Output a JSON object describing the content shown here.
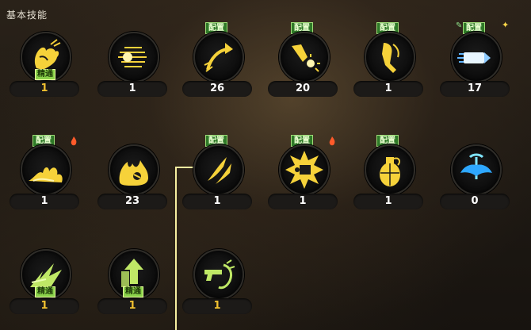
{
  "panel": {
    "title": "基本技能"
  },
  "skills": [
    {
      "count": "1",
      "count_color": "gold",
      "badge": "",
      "mastery": "精通",
      "icon": "muscle-arm-icon"
    },
    {
      "count": "1",
      "count_color": "white",
      "badge": "",
      "mastery": "",
      "icon": "speed-dash-icon"
    },
    {
      "count": "26",
      "count_color": "white",
      "badge": "配置",
      "mastery": "",
      "icon": "arrow-strike-icon"
    },
    {
      "count": "20",
      "count_color": "white",
      "badge": "配置",
      "mastery": "",
      "icon": "heavy-punch-icon"
    },
    {
      "count": "1",
      "count_color": "white",
      "badge": "配置",
      "mastery": "",
      "icon": "leg-kick-icon"
    },
    {
      "count": "17",
      "count_color": "white",
      "badge": "配置",
      "mastery": "",
      "icon": "bullet-icon"
    },
    {
      "count": "1",
      "count_color": "white",
      "badge": "配置",
      "mastery": "",
      "icon": "fire-wave-icon"
    },
    {
      "count": "23",
      "count_color": "white",
      "badge": "",
      "mastery": "",
      "icon": "flame-beast-icon"
    },
    {
      "count": "1",
      "count_color": "white",
      "badge": "配置",
      "mastery": "",
      "icon": "slash-claw-icon"
    },
    {
      "count": "1",
      "count_color": "white",
      "badge": "配置",
      "mastery": "",
      "icon": "explosion-icon"
    },
    {
      "count": "1",
      "count_color": "white",
      "badge": "配置",
      "mastery": "",
      "icon": "grenade-icon"
    },
    {
      "count": "0",
      "count_color": "white",
      "badge": "",
      "mastery": "",
      "icon": "blue-eagle-icon"
    },
    {
      "count": "1",
      "count_color": "gold",
      "badge": "",
      "mastery": "精通",
      "icon": "green-burst-icon"
    },
    {
      "count": "1",
      "count_color": "gold",
      "badge": "",
      "mastery": "精通",
      "icon": "upgrade-arrow-icon"
    },
    {
      "count": "1",
      "count_color": "gold",
      "badge": "",
      "mastery": "",
      "icon": "pistol-dragon-icon"
    }
  ],
  "colors": {
    "accent_gold": "#f2c230",
    "badge_green": "#2f7a28",
    "mastery_green": "#8ad14a",
    "connector": "#f6eea0"
  }
}
